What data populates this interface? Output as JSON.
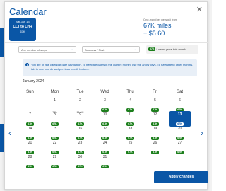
{
  "modal": {
    "title": "Calendar",
    "close": "✕"
  },
  "selected": {
    "date": "Sat Jan 13",
    "route": "CLT to LHR",
    "miles": "67K"
  },
  "price": {
    "label": "One-way (per person) from",
    "miles": "67K miles",
    "usd": "+ $5.60"
  },
  "filters": {
    "stops_label": "Any number of stops",
    "cabin_label": "Business / First",
    "legend_pill": "67K",
    "legend_text": "Lowest price this month"
  },
  "info_text": "You are on the calendar date navigation. To navigate dates in the current month, use the arrow keys. To navigate to other months, tab to next month and previous month buttons.",
  "month_label": "January 2024",
  "weekdays": [
    "Sun",
    "Mon",
    "Tue",
    "Wed",
    "Thu",
    "Fri",
    "Sat"
  ],
  "days": [
    {
      "n": "1",
      "p": "77k",
      "g": false
    },
    {
      "n": "2",
      "p": "11.5K",
      "g": false
    },
    {
      "n": "3",
      "p": "67K",
      "g": true
    },
    {
      "n": "4",
      "p": "67K",
      "g": true
    },
    {
      "n": "5",
      "p": "67K",
      "g": true
    },
    {
      "n": "6",
      "p": "67K",
      "g": true
    },
    {
      "n": "7",
      "p": "67K",
      "g": true
    },
    {
      "n": "8",
      "p": "67K",
      "g": true
    },
    {
      "n": "9",
      "p": "67K",
      "g": true
    },
    {
      "n": "10",
      "p": "67K",
      "g": true
    },
    {
      "n": "11",
      "p": "67K",
      "g": true
    },
    {
      "n": "12",
      "p": "67K",
      "g": true
    },
    {
      "n": "13",
      "p": "67K",
      "g": true
    },
    {
      "n": "14",
      "p": "67K",
      "g": true
    },
    {
      "n": "15",
      "p": "67K",
      "g": true
    },
    {
      "n": "16",
      "p": "67K",
      "g": true
    },
    {
      "n": "17",
      "p": "67K",
      "g": true
    },
    {
      "n": "18",
      "p": "67K",
      "g": true
    },
    {
      "n": "19",
      "p": "67K",
      "g": true
    },
    {
      "n": "20",
      "p": "67K",
      "g": true
    },
    {
      "n": "21",
      "p": "67K",
      "g": true
    },
    {
      "n": "22",
      "p": "67K",
      "g": true
    },
    {
      "n": "23",
      "p": "67K",
      "g": true
    },
    {
      "n": "24",
      "p": "67K",
      "g": true
    },
    {
      "n": "25",
      "p": "67K",
      "g": true
    },
    {
      "n": "26",
      "p": "67K",
      "g": true
    },
    {
      "n": "27",
      "p": "67K",
      "g": true
    },
    {
      "n": "28",
      "p": "67K",
      "g": true
    },
    {
      "n": "29",
      "p": "67K",
      "g": true
    },
    {
      "n": "30",
      "p": "67K",
      "g": true
    },
    {
      "n": "31",
      "p": "67K",
      "g": true
    }
  ],
  "apply_label": "Apply changes",
  "nav": {
    "prev": "‹",
    "next": "›"
  },
  "colors": {
    "brand": "#0a56a6",
    "price_green": "#1b7e1b"
  }
}
